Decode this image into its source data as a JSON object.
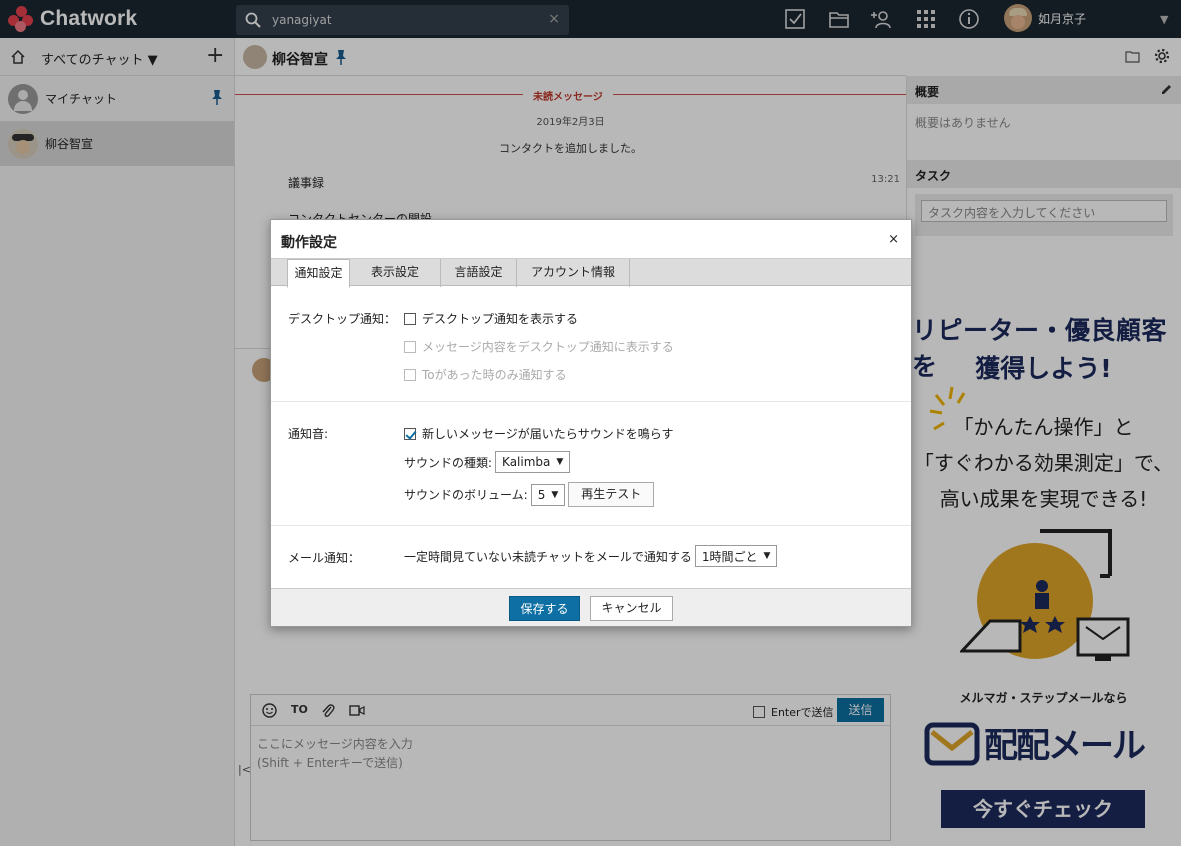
{
  "app": {
    "name": "Chatwork"
  },
  "search": {
    "value": "yanagiyat",
    "clear": "×"
  },
  "user": {
    "name": "如月京子"
  },
  "sidebar": {
    "filter_label": "すべてのチャット ▼",
    "add": "+",
    "rooms": [
      {
        "label": "マイチャット",
        "pinned": true
      },
      {
        "label": "柳谷智宣",
        "active": true
      }
    ]
  },
  "chat": {
    "title": "柳谷智宣",
    "unread_label": "未読メッセージ",
    "date": "2019年2月3日",
    "system_msg": "コンタクトを追加しました。",
    "messages": [
      {
        "text": "議事録",
        "time": "13:21"
      },
      {
        "text": "コンタクトセンターの開設"
      }
    ],
    "composer": {
      "to": "TO",
      "enter_send": "Enterで送信",
      "send": "送信",
      "placeholder_line1": "ここにメッセージ内容を入力",
      "placeholder_line2": "(Shift + Enterキーで送信)",
      "collapse": "|<"
    }
  },
  "right_panel": {
    "summary_title": "概要",
    "summary_text": "概要はありません",
    "task_title": "タスク",
    "task_placeholder": "タスク内容を入力してください"
  },
  "ad": {
    "headline1": "リピーター・優良顧客を",
    "headline2": "獲得しよう!",
    "line1": "「かんたん操作」と",
    "line2": "「すぐわかる効果測定」で、",
    "line3": "高い成果を実現できる!",
    "sub": "メルマガ・ステップメールなら",
    "brand": "配配メール",
    "cta": "今すぐチェック"
  },
  "dialog": {
    "title": "動作設定",
    "close": "×",
    "tabs": [
      "通知設定",
      "表示設定",
      "言語設定",
      "アカウント情報"
    ],
    "desktop": {
      "label": "デスクトップ通知：",
      "show": "デスクトップ通知を表示する",
      "content": "メッセージ内容をデスクトップ通知に表示する",
      "to_only": "Toがあった時のみ通知する"
    },
    "sound": {
      "label": "通知音:",
      "play": "新しいメッセージが届いたらサウンドを鳴らす",
      "type_label": "サウンドの種類:",
      "type_value": "Kalimba",
      "volume_label": "サウンドのボリューム:",
      "volume_value": "5",
      "test_button": "再生テスト"
    },
    "mail": {
      "label": "メール通知：",
      "text": "一定時間見ていない未読チャットをメールで通知する",
      "value": "1時間ごと"
    },
    "save": "保存する",
    "cancel": "キャンセル"
  },
  "colors": {
    "header_bg": "#1b2631",
    "accent": "#0d6fa3",
    "unread_red": "#c0392b",
    "ad_navy": "#1c2a5e"
  }
}
